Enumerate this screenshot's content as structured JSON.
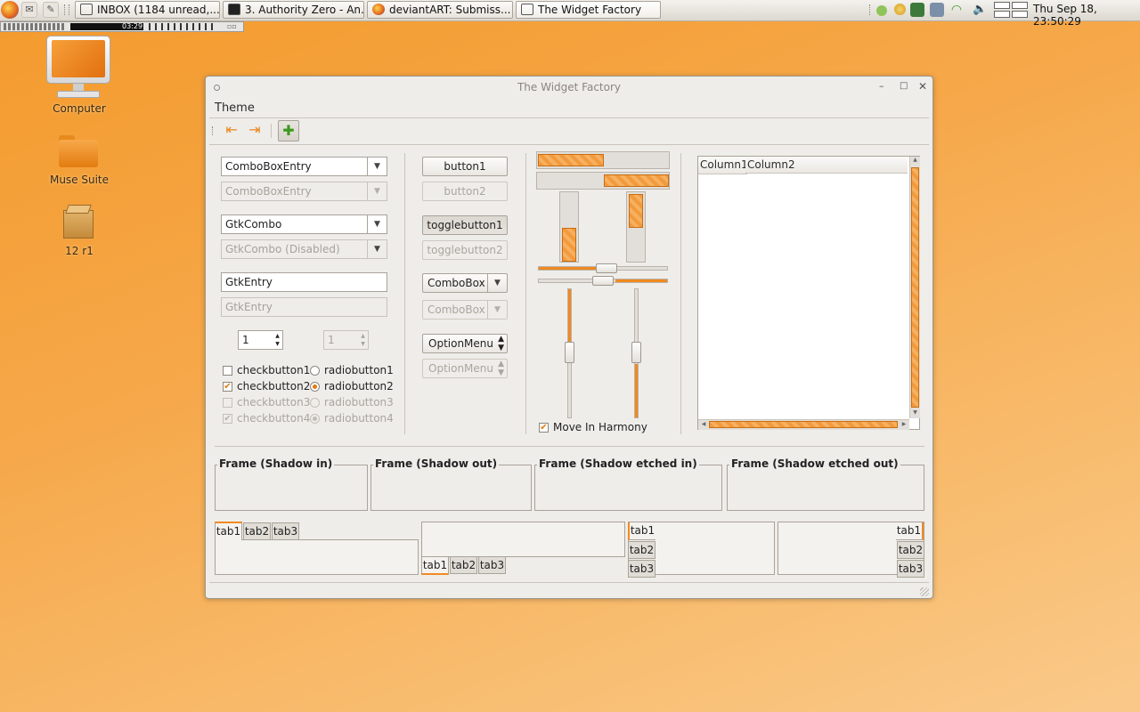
{
  "panel": {
    "tasks": [
      {
        "label": "INBOX (1184 unread,..."
      },
      {
        "label": "3. Authority Zero - An..."
      },
      {
        "label": "deviantART: Submiss..."
      },
      {
        "label": "The Widget Factory"
      }
    ],
    "clock": "Thu Sep 18, 23:50:29"
  },
  "mediabar": {
    "time": "03:29"
  },
  "desktop": {
    "icons": [
      {
        "label": "Computer"
      },
      {
        "label": "Muse Suite"
      },
      {
        "label": "12 r1"
      }
    ]
  },
  "window": {
    "title": "The Widget Factory",
    "menu": {
      "theme": "Theme"
    },
    "combo_entry": "ComboBoxEntry",
    "combo_entry_disabled": "ComboBoxEntry",
    "gtk_combo": "GtkCombo",
    "gtk_combo_disabled": "GtkCombo (Disabled)",
    "entry": "GtkEntry",
    "entry_disabled_placeholder": "GtkEntry",
    "spin1": "1",
    "spin2": "1",
    "checks": [
      {
        "label": "checkbutton1",
        "checked": false,
        "disabled": false
      },
      {
        "label": "checkbutton2",
        "checked": true,
        "disabled": false
      },
      {
        "label": "checkbutton3",
        "checked": false,
        "disabled": true
      },
      {
        "label": "checkbutton4",
        "checked": true,
        "disabled": true
      }
    ],
    "radios": [
      {
        "label": "radiobutton1",
        "selected": false,
        "disabled": false
      },
      {
        "label": "radiobutton2",
        "selected": true,
        "disabled": false
      },
      {
        "label": "radiobutton3",
        "selected": false,
        "disabled": true
      },
      {
        "label": "radiobutton4",
        "selected": true,
        "disabled": true
      }
    ],
    "button1": "button1",
    "button2": "button2",
    "togglebutton1": "togglebutton1",
    "togglebutton2": "togglebutton2",
    "combobox": "ComboBox",
    "combobox_disabled": "ComboBox",
    "optionmenu": "OptionMenu",
    "optionmenu_disabled": "OptionMenu",
    "move_in_harmony": "Move In Harmony",
    "tree": {
      "columns": [
        "Column1",
        "Column2"
      ]
    },
    "frames": [
      {
        "title": "Frame (Shadow in)"
      },
      {
        "title": "Frame (Shadow out)"
      },
      {
        "title": "Frame (Shadow etched in)"
      },
      {
        "title": "Frame (Shadow etched out)"
      }
    ],
    "tabs": [
      "tab1",
      "tab2",
      "tab3"
    ]
  },
  "colors": {
    "accent": "#f29a3c",
    "desktop": "#f6a84a"
  }
}
